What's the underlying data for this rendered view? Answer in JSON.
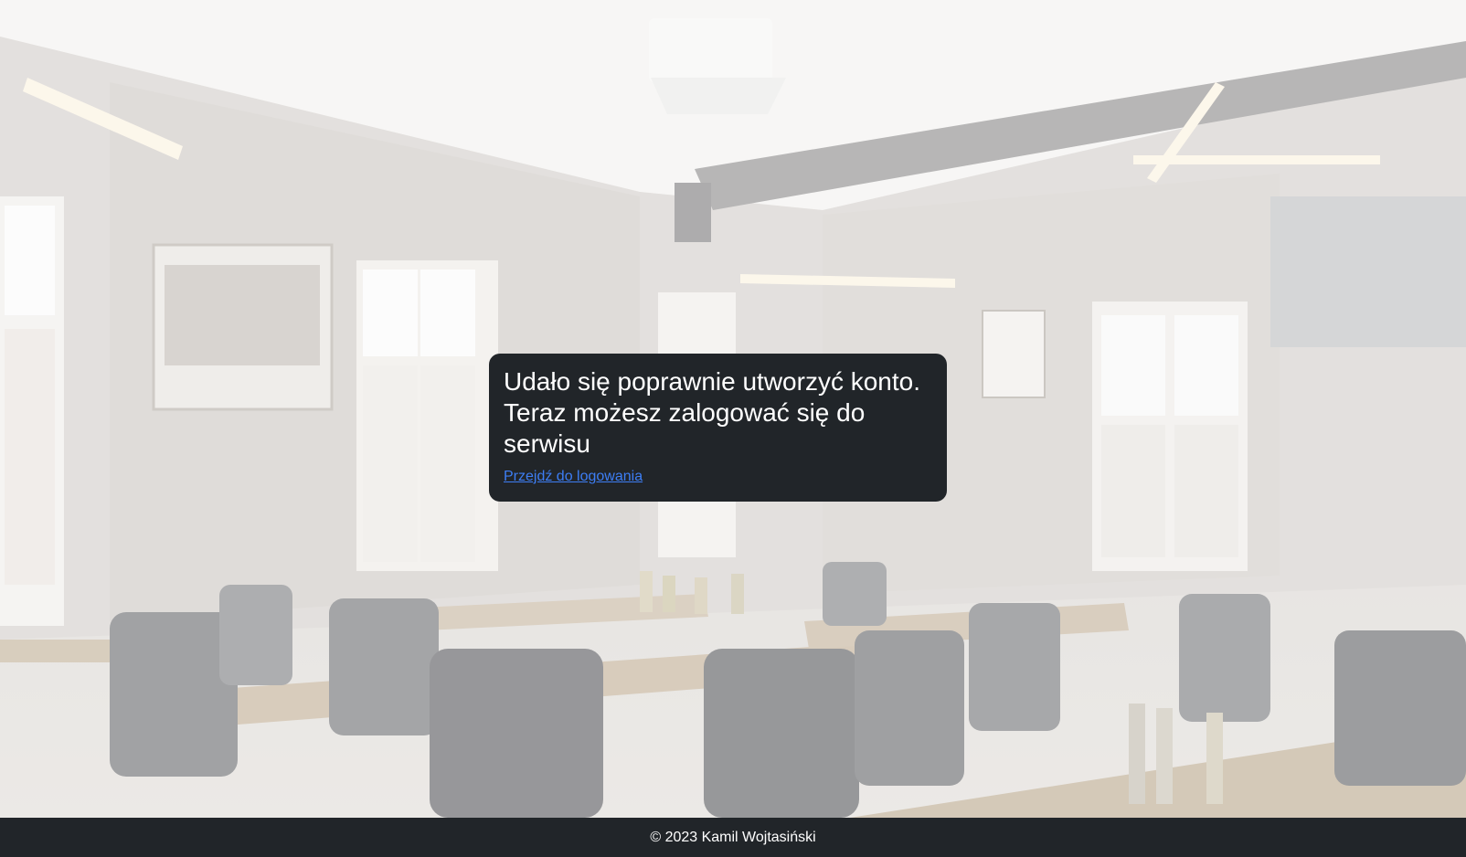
{
  "message": {
    "title": "Udało się poprawnie utworzyć konto. Teraz możesz zalogować się do serwisu",
    "link_label": "Przejdź do logowania"
  },
  "footer": {
    "copyright": "© 2023 Kamil Wojtasiński"
  },
  "colors": {
    "card_background": "#212529",
    "footer_background": "#212529",
    "link": "#3d7ef5",
    "text": "#ffffff"
  }
}
